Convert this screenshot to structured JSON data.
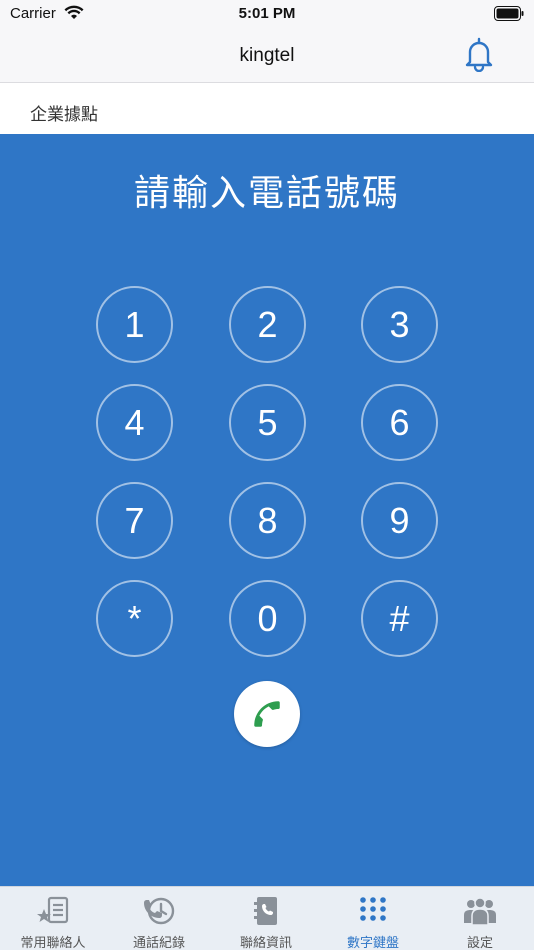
{
  "status_bar": {
    "carrier": "Carrier",
    "time": "5:01 PM"
  },
  "nav": {
    "title": "kingtel"
  },
  "site": {
    "label": "企業據點"
  },
  "dialer": {
    "prompt": "請輸入電話號碼",
    "keys": [
      "1",
      "2",
      "3",
      "4",
      "5",
      "6",
      "7",
      "8",
      "9",
      "*",
      "0",
      "#"
    ]
  },
  "tabs": [
    {
      "label": "常用聯絡人",
      "icon": "star-list-icon"
    },
    {
      "label": "通話紀錄",
      "icon": "call-history-icon"
    },
    {
      "label": "聯絡資訊",
      "icon": "contact-book-icon"
    },
    {
      "label": "數字鍵盤",
      "icon": "keypad-grid-icon",
      "active": true
    },
    {
      "label": "設定",
      "icon": "people-settings-icon"
    }
  ],
  "colors": {
    "accent": "#2f76c6",
    "call_green": "#2e9e4f",
    "tab_icon": "#8a9199"
  }
}
